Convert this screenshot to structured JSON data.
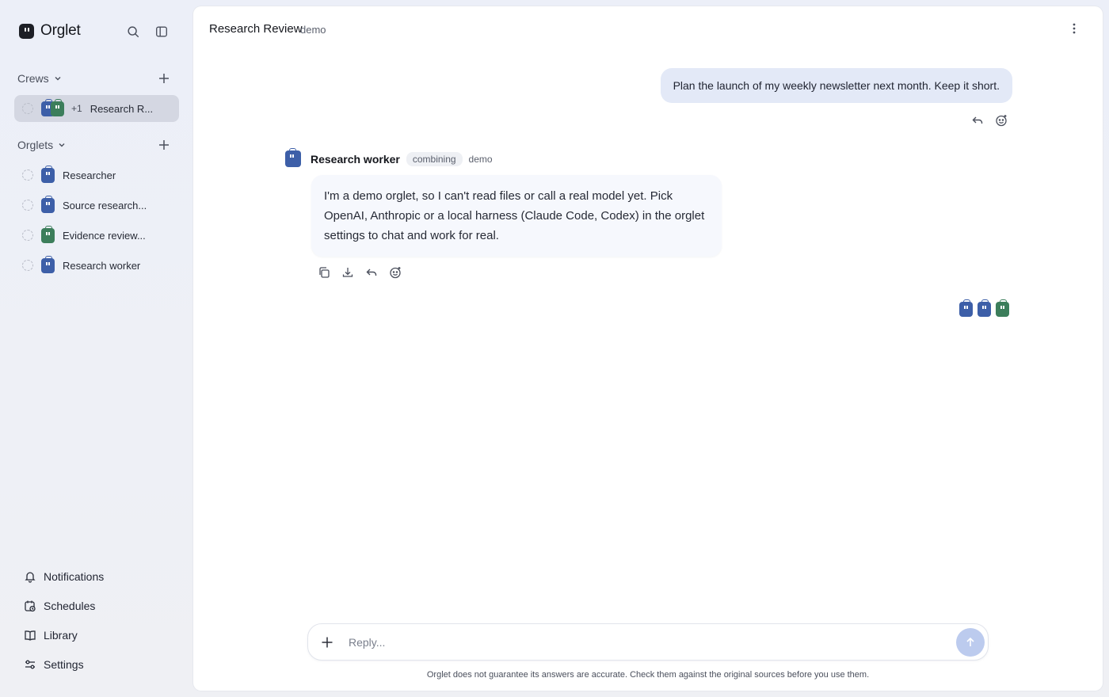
{
  "app": {
    "name": "Orglet"
  },
  "sidebar": {
    "crews": {
      "label": "Crews",
      "items": [
        {
          "label": "Research R...",
          "extra_count": "+1"
        }
      ]
    },
    "orglets": {
      "label": "Orglets",
      "items": [
        {
          "label": "Researcher",
          "color": "blue"
        },
        {
          "label": "Source research...",
          "color": "blue"
        },
        {
          "label": "Evidence review...",
          "color": "green"
        },
        {
          "label": "Research worker",
          "color": "blue"
        }
      ]
    },
    "bottom": [
      {
        "label": "Notifications",
        "icon": "bell-icon"
      },
      {
        "label": "Schedules",
        "icon": "calendar-clock-icon"
      },
      {
        "label": "Library",
        "icon": "book-icon"
      },
      {
        "label": "Settings",
        "icon": "sliders-icon"
      }
    ]
  },
  "header": {
    "title": "Research Review",
    "badge": "demo"
  },
  "conversation": {
    "user_message": "Plan the launch of my weekly newsletter next month. Keep it short.",
    "agent": {
      "name": "Research worker",
      "status": "combining",
      "tag": "demo",
      "message": "I'm a demo orglet, so I can't read files or call a real model yet. Pick OpenAI, Anthropic or a local harness (Claude Code, Codex) in the orglet settings to chat and work for real."
    }
  },
  "composer": {
    "placeholder": "Reply...",
    "value": "",
    "disclaimer": "Orglet does not guarantee its answers are accurate. Check them against the original sources before you use them."
  },
  "colors": {
    "bot_blue": "#3d5fa8",
    "bot_green": "#3c7e5b",
    "user_bubble": "#e3e9f7",
    "send_button": "#bccbee",
    "active_item": "#d4d7e2"
  }
}
